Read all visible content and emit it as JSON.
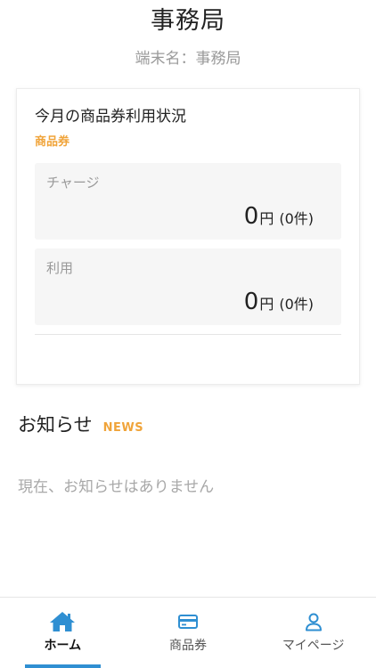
{
  "header": {
    "title": "事務局",
    "terminal_label": "端末名：事務局"
  },
  "usage_card": {
    "title": "今月の商品券利用状況",
    "subtitle": "商品券",
    "charge": {
      "label": "チャージ",
      "amount": "0",
      "unit": "円",
      "count": "(0件)"
    },
    "use": {
      "label": "利用",
      "amount": "0",
      "unit": "円",
      "count": "(0件)"
    }
  },
  "news": {
    "title": "お知らせ",
    "badge": "NEWS",
    "empty_message": "現在、お知らせはありません"
  },
  "tabbar": {
    "items": [
      {
        "label": "ホーム",
        "icon": "home-icon",
        "active": true
      },
      {
        "label": "商品券",
        "icon": "card-icon",
        "active": false
      },
      {
        "label": "マイページ",
        "icon": "person-icon",
        "active": false
      }
    ]
  },
  "colors": {
    "accent": "#f0a43a",
    "brand_blue": "#2f8fd2",
    "muted_text": "#9a9a9a"
  }
}
